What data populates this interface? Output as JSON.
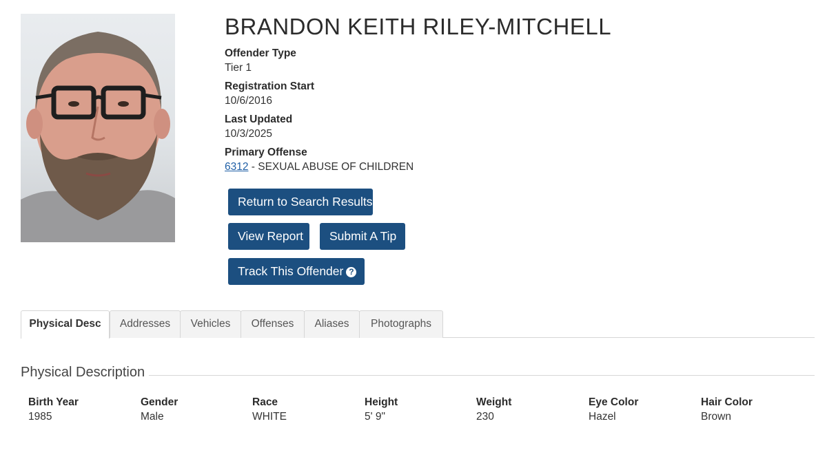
{
  "offender": {
    "name": "BRANDON KEITH RILEY-MITCHELL",
    "offender_type_label": "Offender Type",
    "offender_type": "Tier 1",
    "registration_start_label": "Registration Start",
    "registration_start": "10/6/2016",
    "last_updated_label": "Last Updated",
    "last_updated": "10/3/2025",
    "primary_offense_label": "Primary Offense",
    "primary_offense_code": "6312",
    "primary_offense_desc": " - SEXUAL ABUSE OF CHILDREN"
  },
  "buttons": {
    "return": "Return to Search Results",
    "view_report": "View Report",
    "submit_tip": "Submit A Tip",
    "track": "Track This Offender",
    "track_icon": "question-circle-icon"
  },
  "tabs": [
    {
      "label": "Physical Desc",
      "active": true
    },
    {
      "label": "Addresses",
      "active": false
    },
    {
      "label": "Vehicles",
      "active": false
    },
    {
      "label": "Offenses",
      "active": false
    },
    {
      "label": "Aliases",
      "active": false
    },
    {
      "label": "Photographs",
      "active": false
    }
  ],
  "physical": {
    "title": "Physical Description",
    "fields": [
      {
        "label": "Birth Year",
        "value": "1985"
      },
      {
        "label": "Gender",
        "value": "Male"
      },
      {
        "label": "Race",
        "value": "WHITE"
      },
      {
        "label": "Height",
        "value": "5' 9\""
      },
      {
        "label": "Weight",
        "value": "230"
      },
      {
        "label": "Eye Color",
        "value": "Hazel"
      },
      {
        "label": "Hair Color",
        "value": "Brown"
      }
    ]
  },
  "colors": {
    "button": "#1c4f80",
    "link": "#1f5fa6"
  }
}
